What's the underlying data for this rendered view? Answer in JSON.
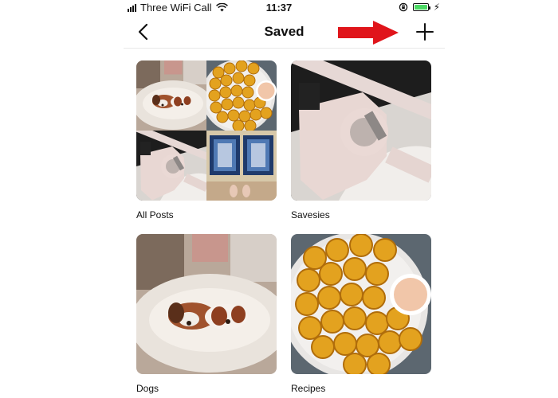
{
  "status_bar": {
    "carrier": "Three WiFi Call",
    "time": "11:37",
    "battery_color": "#4cd964"
  },
  "header": {
    "title": "Saved",
    "back_icon": "chevron-left-icon",
    "add_icon": "plus-icon"
  },
  "annotation": {
    "arrow_color": "#e0151b"
  },
  "collections": [
    {
      "name": "All Posts",
      "thumbnail": "grid-of-4-recent-posts"
    },
    {
      "name": "Savesies",
      "thumbnail": "hair-dryer-photo"
    },
    {
      "name": "Dogs",
      "thumbnail": "dogs-in-bed-photo"
    },
    {
      "name": "Recipes",
      "thumbnail": "zucchini-chips-photo"
    }
  ]
}
